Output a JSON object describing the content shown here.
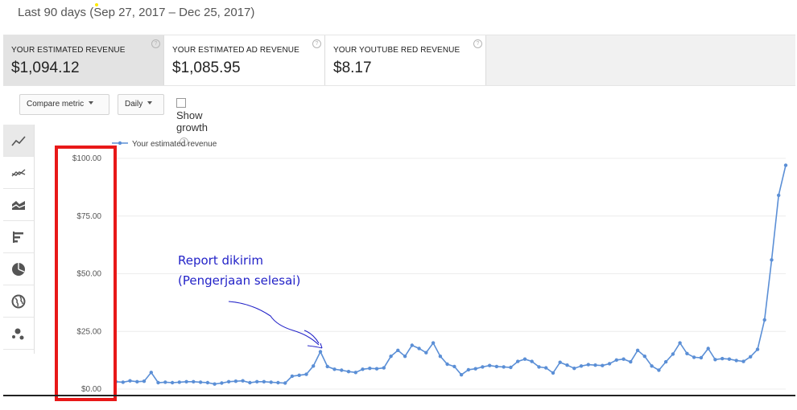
{
  "header": {
    "date_range": "Last 90 days (Sep 27, 2017 – Dec 25, 2017)"
  },
  "metrics": [
    {
      "label": "YOUR ESTIMATED REVENUE",
      "value": "$1,094.12",
      "active": true
    },
    {
      "label": "YOUR ESTIMATED AD REVENUE",
      "value": "$1,085.95",
      "active": false
    },
    {
      "label": "YOUR YOUTUBE RED REVENUE",
      "value": "$8.17",
      "active": false
    }
  ],
  "controls": {
    "compare_metric": "Compare metric",
    "interval": "Daily",
    "show_growth": "Show growth",
    "show_growth_checked": false
  },
  "sidebar": {
    "items": [
      {
        "icon": "line-chart-icon",
        "active": true
      },
      {
        "icon": "multiline-chart-icon",
        "active": false
      },
      {
        "icon": "stacked-area-chart-icon",
        "active": false
      },
      {
        "icon": "bar-chart-icon",
        "active": false
      },
      {
        "icon": "pie-chart-icon",
        "active": false
      },
      {
        "icon": "globe-icon",
        "active": false
      },
      {
        "icon": "bubble-chart-icon",
        "active": false
      }
    ]
  },
  "annotation": {
    "line1": "Report dikirim",
    "line2": "(Pengerjaan selesai)",
    "color": "#2323c8",
    "highlight_color": "#e81818"
  },
  "chart_data": {
    "type": "line",
    "title": "",
    "xlabel": "",
    "ylabel": "",
    "ylim": [
      0,
      100
    ],
    "yticks": [
      "$0.00",
      "$25.00",
      "$50.00",
      "$75.00",
      "$100.00"
    ],
    "grid": true,
    "legend": "top-left",
    "color": "#5b8fd6",
    "series": [
      {
        "name": "Your estimated revenue",
        "values": [
          3.2,
          3.0,
          3.6,
          3.2,
          3.4,
          7.2,
          2.8,
          3.0,
          2.8,
          3.0,
          3.2,
          3.2,
          3.0,
          2.8,
          2.2,
          2.6,
          3.2,
          3.4,
          3.6,
          2.8,
          3.2,
          3.2,
          3.0,
          2.8,
          2.6,
          5.6,
          6.0,
          6.4,
          10.0,
          16.2,
          9.8,
          8.6,
          8.2,
          7.6,
          7.2,
          8.6,
          9.0,
          8.8,
          9.2,
          14.2,
          16.8,
          14.2,
          19.0,
          17.6,
          15.8,
          20.0,
          14.2,
          10.8,
          9.8,
          6.2,
          8.4,
          8.8,
          9.6,
          10.2,
          9.8,
          9.6,
          9.4,
          12.0,
          13.0,
          12.0,
          9.6,
          9.2,
          7.0,
          11.6,
          10.4,
          9.0,
          10.0,
          10.6,
          10.4,
          10.2,
          11.0,
          12.6,
          13.0,
          11.8,
          16.8,
          14.2,
          10.0,
          8.2,
          11.8,
          15.2,
          20.0,
          15.4,
          13.8,
          13.6,
          17.6,
          12.8,
          13.2,
          13.0,
          12.4,
          12.0,
          14.0,
          17.2,
          30.0,
          56.0,
          84.0,
          97.0
        ]
      }
    ]
  }
}
